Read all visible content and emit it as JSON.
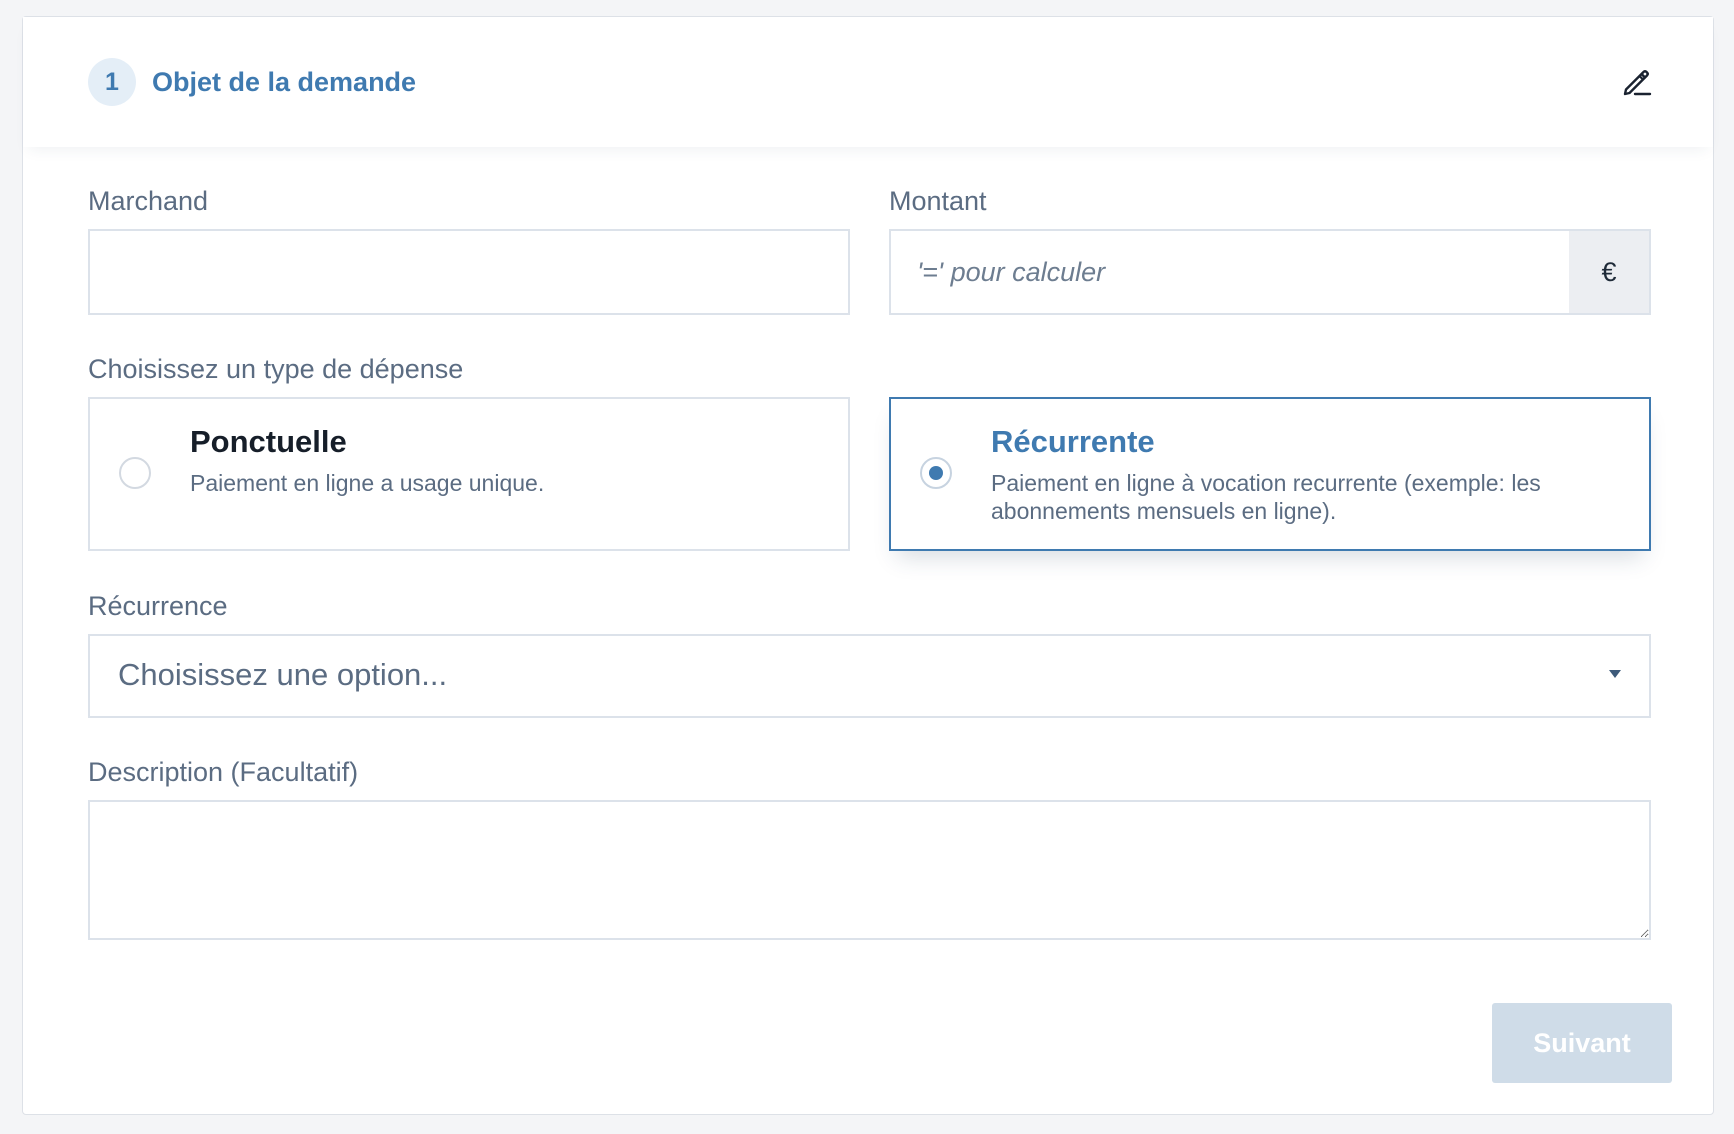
{
  "step": {
    "number": "1",
    "title": "Objet de la demande"
  },
  "icons": {
    "edit": "pencil-icon",
    "currency": "euro-icon",
    "dropdown": "caret-down-icon"
  },
  "merchant": {
    "label": "Marchand",
    "value": "",
    "placeholder": ""
  },
  "amount": {
    "label": "Montant",
    "value": "",
    "placeholder": "'=' pour calculer",
    "currency": "€"
  },
  "expense_type": {
    "label": "Choisissez un type de dépense",
    "options": [
      {
        "title": "Ponctuelle",
        "description": "Paiement en ligne a usage unique.",
        "selected": false
      },
      {
        "title": "Récurrente",
        "description": "Paiement en ligne à vocation recurrente (exemple: les abonnements mensuels en ligne).",
        "selected": true
      }
    ]
  },
  "recurrence": {
    "label": "Récurrence",
    "selected": "Choisissez une option..."
  },
  "description": {
    "label": "Description (Facultatif)",
    "value": ""
  },
  "actions": {
    "next_label": "Suivant"
  },
  "colors": {
    "accent": "#3f7ab0",
    "accent_light": "#e4eef7",
    "button_disabled": "#cfdce8",
    "border": "#dce2ea",
    "label_text": "#5b6c82"
  }
}
